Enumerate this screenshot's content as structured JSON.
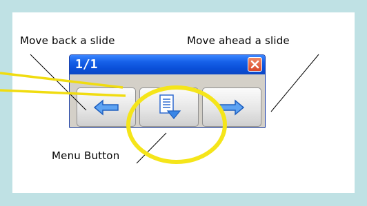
{
  "labels": {
    "back": "Move back a slide",
    "ahead": "Move ahead a slide",
    "menu": "Menu Button"
  },
  "window": {
    "counter": "1/1",
    "close_icon": "close-icon",
    "buttons": {
      "back_icon": "arrow-left-icon",
      "menu_icon": "menu-document-down-icon",
      "ahead_icon": "arrow-right-icon"
    }
  },
  "colors": {
    "background": "#bfe1e4",
    "titlebar": "#1660e8",
    "highlight": "#f5e51a",
    "arrow": "#2f7fe0"
  }
}
